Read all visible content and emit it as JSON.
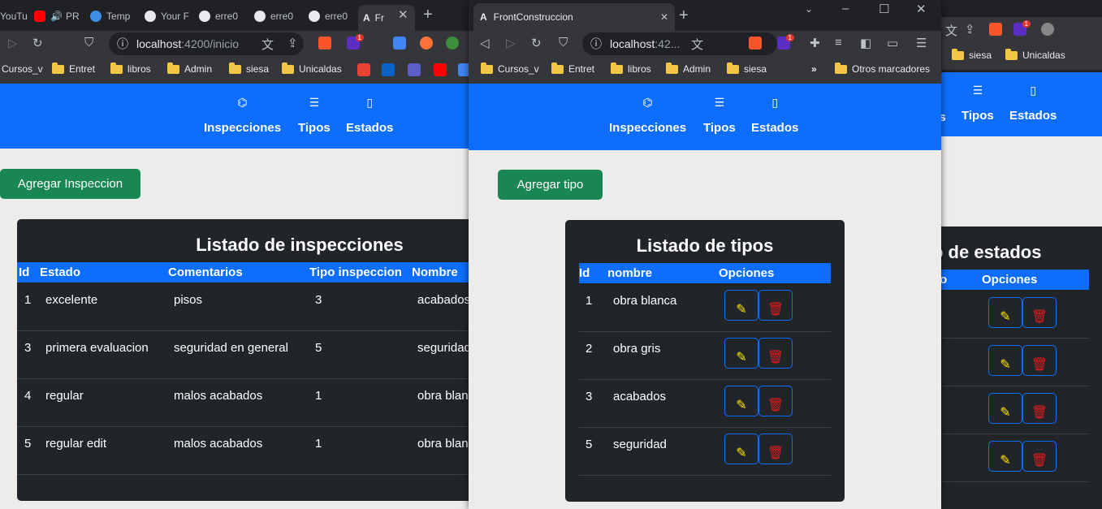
{
  "left": {
    "tabs": [
      "YouTu",
      "PR",
      "Temp",
      "Your F",
      "erre0",
      "erre0",
      "erre0",
      "Fr"
    ],
    "url_host": "localhost",
    "url_path": ":4200/inicio",
    "bookmarks": [
      "Cursos_v",
      "Entret",
      "libros",
      "Admin",
      "siesa",
      "Unicaldas"
    ],
    "nav": [
      "Inspecciones",
      "Tipos",
      "Estados"
    ],
    "add_button": "Agregar Inspeccion",
    "card_title": "Listado de inspecciones",
    "columns": [
      "Id",
      "Estado",
      "Comentarios",
      "Tipo inspeccion",
      "Nombre"
    ],
    "rows": [
      [
        "1",
        "excelente",
        "pisos",
        "3",
        "acabados"
      ],
      [
        "3",
        "primera evaluacion",
        "seguridad en general",
        "5",
        "seguridad"
      ],
      [
        "4",
        "regular",
        "malos acabados",
        "1",
        "obra blanca"
      ],
      [
        "5",
        "regular edit",
        "malos acabados",
        "1",
        "obra blanca"
      ]
    ]
  },
  "middle": {
    "tab_title": "FrontConstruccion",
    "url_host": "localhost",
    "url_path": ":42...",
    "bookmarks": [
      "Cursos_v",
      "Entret",
      "libros",
      "Admin",
      "siesa"
    ],
    "more_bookmarks": "»",
    "other_bookmarks": "Otros marcadores",
    "nav": [
      "Inspecciones",
      "Tipos",
      "Estados"
    ],
    "add_button": "Agregar tipo",
    "card_title": "Listado de tipos",
    "columns": [
      "Id",
      "nombre",
      "Opciones"
    ],
    "rows": [
      [
        "1",
        "obra blanca"
      ],
      [
        "2",
        "obra gris"
      ],
      [
        "3",
        "acabados"
      ],
      [
        "5",
        "seguridad"
      ]
    ]
  },
  "right": {
    "bookmarks": [
      "siesa",
      "Unicaldas"
    ],
    "nav": [
      "es",
      "Tipos",
      "Estados"
    ],
    "card_title": "o de estados",
    "columns": [
      "do",
      "Opciones"
    ]
  },
  "icons": {
    "edit": "✎",
    "delete": "🗑"
  },
  "colors": {
    "primary": "#0d6efd",
    "success": "#198754",
    "card": "#212529",
    "page": "#eeecea"
  }
}
